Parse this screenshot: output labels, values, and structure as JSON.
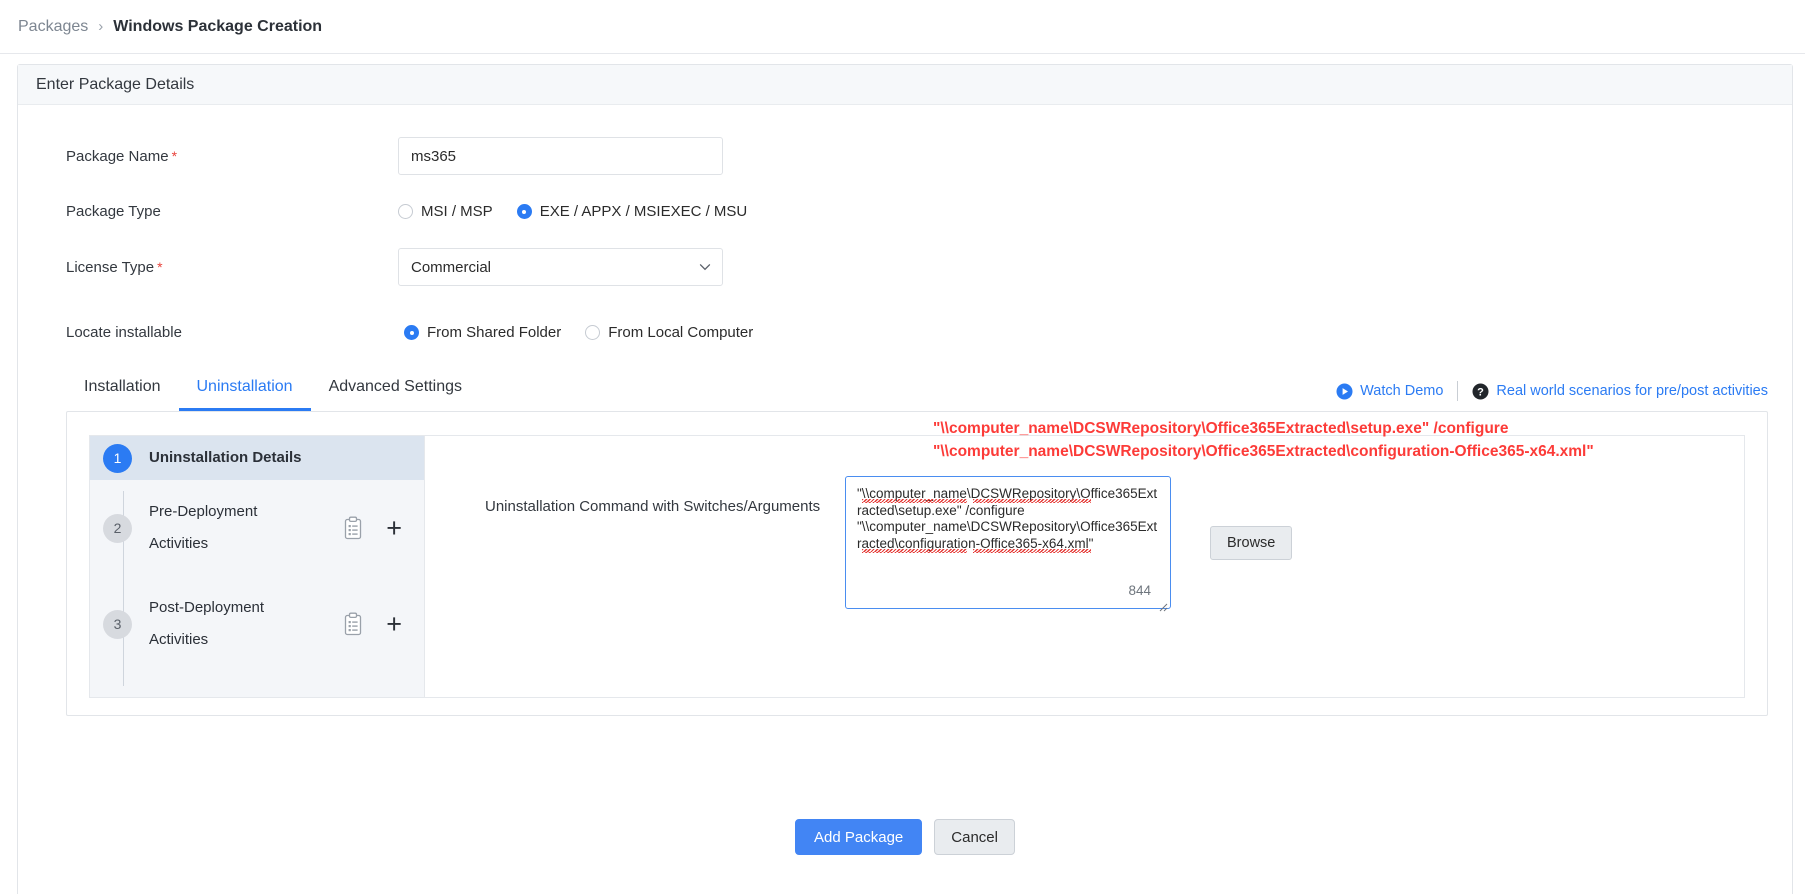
{
  "breadcrumb": {
    "parent": "Packages",
    "separator": "›",
    "current": "Windows Package Creation"
  },
  "card": {
    "header": "Enter Package Details"
  },
  "form": {
    "package_name": {
      "label": "Package Name",
      "required_mark": "*",
      "value": "ms365",
      "placeholder": ""
    },
    "package_type": {
      "label": "Package Type",
      "options": [
        {
          "label": "MSI / MSP",
          "selected": false
        },
        {
          "label": "EXE / APPX / MSIEXEC / MSU",
          "selected": true
        }
      ]
    },
    "license_type": {
      "label": "License Type",
      "required_mark": "*",
      "value": "Commercial",
      "chevron_icon": "chevron-down-icon"
    },
    "locate_installable": {
      "label": "Locate installable",
      "options": [
        {
          "label": "From Shared Folder",
          "selected": true
        },
        {
          "label": "From Local Computer",
          "selected": false
        }
      ]
    }
  },
  "tabs": [
    {
      "label": "Installation",
      "active": false
    },
    {
      "label": "Uninstallation",
      "active": true
    },
    {
      "label": "Advanced Settings",
      "active": false
    }
  ],
  "tab_links": {
    "watch_demo": {
      "label": "Watch Demo",
      "icon": "play-circle-icon"
    },
    "real_world": {
      "label": "Real world scenarios for pre/post activities",
      "icon": "question-circle-icon"
    }
  },
  "steps": [
    {
      "number": "1",
      "line1": "Uninstallation Details",
      "line2": "",
      "active": true,
      "has_icons": false
    },
    {
      "number": "2",
      "line1": "Pre-Deployment",
      "line2": "Activities",
      "active": false,
      "has_icons": true,
      "clipboard_icon": "clipboard-list-icon",
      "add_icon": "plus-icon"
    },
    {
      "number": "3",
      "line1": "Post-Deployment",
      "line2": "Activities",
      "active": false,
      "has_icons": true,
      "clipboard_icon": "clipboard-list-icon",
      "add_icon": "plus-icon"
    }
  ],
  "uninstall_details": {
    "command_label": "Uninstallation Command with Switches/Arguments",
    "command_value": "\"\\\\computer_name\\DCSWRepository\\Office365Extracted\\setup.exe\" /configure \"\\\\computer_name\\DCSWRepository\\Office365Extracted\\configuration-Office365-x64.xml\"",
    "char_count": "844",
    "browse_label": "Browse",
    "resize_handle_icon": "resize-grip-icon"
  },
  "annotation": {
    "line1": "\"\\\\computer_name\\DCSWRepository\\Office365Extracted\\setup.exe\" /configure",
    "line2": "\"\\\\computer_name\\DCSWRepository\\Office365Extracted\\configuration-Office365-x64.xml\"",
    "color": "#fc3b38"
  },
  "footer": {
    "submit_label": "Add Package",
    "cancel_label": "Cancel"
  },
  "colors": {
    "accent": "#2b7bf3",
    "primary_button": "#4285f4",
    "required": "#e8433c",
    "annotation_red": "#fc3b38",
    "active_step_bg": "#dbe4ef"
  }
}
